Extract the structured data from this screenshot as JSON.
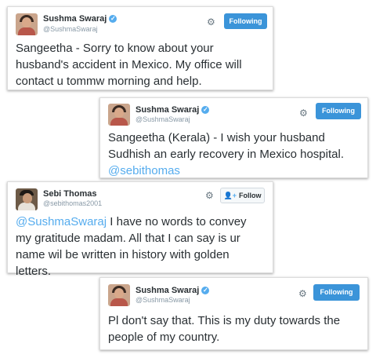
{
  "tweets": [
    {
      "name": "Sushma Swaraj",
      "handle": "@SushmaSwaraj",
      "button": "Following",
      "text_lines": [
        "Sangeetha - Sorry to know about your",
        "husband's accident in Mexico. My office will",
        "contact u tommw morning and help."
      ]
    },
    {
      "name": "Sushma Swaraj",
      "handle": "@SushmaSwaraj",
      "button": "Following",
      "text_lines": [
        "Sangeetha (Kerala) - I wish your husband",
        "Sudhish an early recovery in Mexico hospital."
      ],
      "mention": "@sebithomas"
    },
    {
      "name": "Sebi Thomas",
      "handle": "@sebithomas2001",
      "button": "Follow",
      "mention": "@SushmaSwaraj",
      "text_first_rest": " I have no words to convey",
      "text_lines": [
        "my gratitude madam. All that I can say is ur",
        "name wil be written in  history with golden",
        "letters."
      ]
    },
    {
      "name": "Sushma Swaraj",
      "handle": "@SushmaSwaraj",
      "button": "Following",
      "text_lines": [
        "Pl don't say that. This is my duty towards the",
        "people of my country."
      ]
    }
  ],
  "icons": {
    "verified": "verified-badge-icon",
    "gear": "gear-icon",
    "follow": "add-user-icon"
  },
  "colors": {
    "link": "#55acee",
    "following_button": "#3b94d9",
    "text": "#292f33",
    "handle": "#8899a6"
  }
}
